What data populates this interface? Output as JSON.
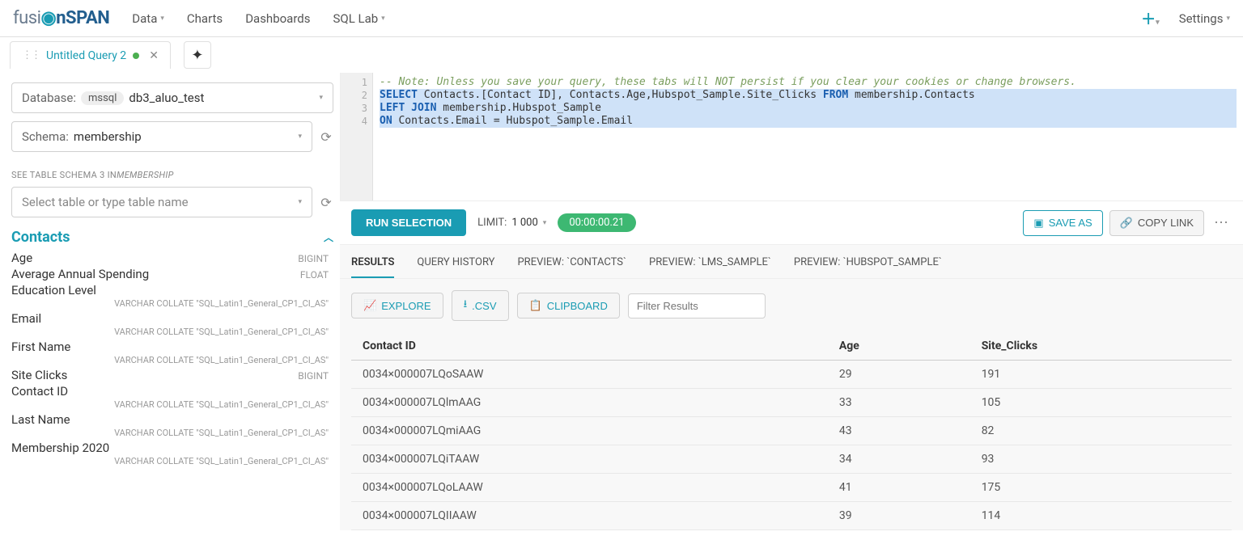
{
  "nav": {
    "logo_fus": "fusi",
    "logo_span": "nSPAN",
    "items": [
      "Data",
      "Charts",
      "Dashboards",
      "SQL Lab"
    ],
    "has_caret": [
      true,
      false,
      false,
      true
    ],
    "settings": "Settings"
  },
  "tab": {
    "title": "Untitled Query 2"
  },
  "sidebar": {
    "db_label": "Database:",
    "db_chip": "mssql",
    "db_name": "db3_aluo_test",
    "schema_label": "Schema:",
    "schema_value": "membership",
    "see_schema": "SEE TABLE SCHEMA",
    "see_schema_count": "3 IN",
    "see_schema_name": "MEMBERSHIP",
    "table_select_placeholder": "Select table or type table name",
    "table_name": "Contacts",
    "columns": [
      {
        "name": "Age",
        "type": "BIGINT"
      },
      {
        "name": "Average Annual Spending",
        "type": "FLOAT"
      },
      {
        "name": "Education Level",
        "type_long": "VARCHAR COLLATE \"SQL_Latin1_General_CP1_CI_AS\""
      },
      {
        "name": "Email",
        "type_long": "VARCHAR COLLATE \"SQL_Latin1_General_CP1_CI_AS\""
      },
      {
        "name": "First Name",
        "type_long": "VARCHAR COLLATE \"SQL_Latin1_General_CP1_CI_AS\""
      },
      {
        "name": "Site Clicks",
        "type": "BIGINT"
      },
      {
        "name": "Contact ID",
        "type_long": "VARCHAR COLLATE \"SQL_Latin1_General_CP1_CI_AS\""
      },
      {
        "name": "Last Name",
        "type_long": "VARCHAR COLLATE \"SQL_Latin1_General_CP1_CI_AS\""
      },
      {
        "name": "Membership 2020",
        "type_long": "VARCHAR COLLATE \"SQL_Latin1_General_CP1_CI_AS\""
      }
    ]
  },
  "editor": {
    "lines": [
      {
        "n": "1",
        "html": "<span class='c-comment'>-- Note: Unless you save your query, these tabs will NOT persist if you clear your cookies or change browsers.</span>"
      },
      {
        "n": "2",
        "sel": true,
        "html": "<span class='c-kw'>SELECT</span> Contacts.[Contact ID], Contacts.Age,Hubspot_Sample.Site_Clicks <span class='c-kw'>FROM</span> membership.Contacts"
      },
      {
        "n": "3",
        "sel": true,
        "html": "<span class='c-kw'>LEFT JOIN</span> membership.Hubspot_Sample"
      },
      {
        "n": "4",
        "sel": true,
        "html": "<span class='c-kw'>ON</span> Contacts.Email = Hubspot_Sample.Email"
      }
    ]
  },
  "runbar": {
    "run": "RUN SELECTION",
    "limit_label": "LIMIT:",
    "limit_value": "1 000",
    "time": "00:00:00.21",
    "save_as": "SAVE AS",
    "copy_link": "COPY LINK"
  },
  "result_tabs": [
    "RESULTS",
    "QUERY HISTORY",
    "PREVIEW: `CONTACTS`",
    "PREVIEW: `LMS_SAMPLE`",
    "PREVIEW: `HUBSPOT_SAMPLE`"
  ],
  "tools": {
    "explore": "EXPLORE",
    "csv": ".CSV",
    "clipboard": "CLIPBOARD",
    "filter_placeholder": "Filter Results"
  },
  "table": {
    "headers": [
      "Contact ID",
      "Age",
      "Site_Clicks"
    ],
    "rows": [
      [
        "0034×000007LQoSAAW",
        "29",
        "191"
      ],
      [
        "0034×000007LQlmAAG",
        "33",
        "105"
      ],
      [
        "0034×000007LQmiAAG",
        "43",
        "82"
      ],
      [
        "0034×000007LQiTAAW",
        "34",
        "93"
      ],
      [
        "0034×000007LQoLAAW",
        "41",
        "175"
      ],
      [
        "0034×000007LQIIAAW",
        "39",
        "114"
      ]
    ]
  }
}
